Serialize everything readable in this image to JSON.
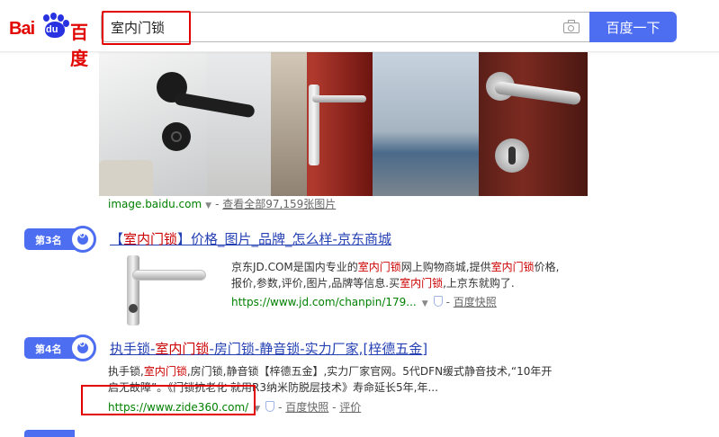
{
  "header": {
    "logo_text_left": "Bai",
    "logo_paw_text": "du",
    "logo_text_right": "百度",
    "search_value": "室内门锁",
    "search_button": "百度一下",
    "camera_icon": "camera-icon"
  },
  "gallery": {
    "source": "image.baidu.com",
    "view_all": "查看全部97,159张图片"
  },
  "results": [
    {
      "rank": "第3名",
      "title_pre": "【",
      "title_em": "室内门锁",
      "title_post": "】价格_图片_品牌_怎么样-京东商城",
      "desc_l1_a": "京东JD.COM是国内专业的",
      "desc_l1_em1": "室内门锁",
      "desc_l1_b": "网上购物商城,提供",
      "desc_l1_em2": "室内门锁",
      "desc_l1_c": "价格,",
      "desc_l2_a": "报价,参数,评价,图片,品牌等信息.买",
      "desc_l2_em": "室内门锁",
      "desc_l2_b": ",上京东就购了.",
      "url": "https://www.jd.com/chanpin/179...",
      "snapshot": "百度快照"
    },
    {
      "rank": "第4名",
      "title_a": "执手锁-",
      "title_em": "室内门锁",
      "title_b": "-房门锁-静音锁-实力厂家,[梓德五金]",
      "desc_l1_a": "执手锁,",
      "desc_l1_em": "室内门锁",
      "desc_l1_b": ",房门锁,静音锁【梓德五金】,实力厂家官网。5代DFN缓式静音技术,“10年开",
      "desc_l2": "启无故障”。《门锁抗老化 就用R3纳米防脱层技术》寿命延长5年,年...",
      "url": "https://www.zide360.com/",
      "snapshot": "百度快照",
      "review": "评价"
    }
  ]
}
